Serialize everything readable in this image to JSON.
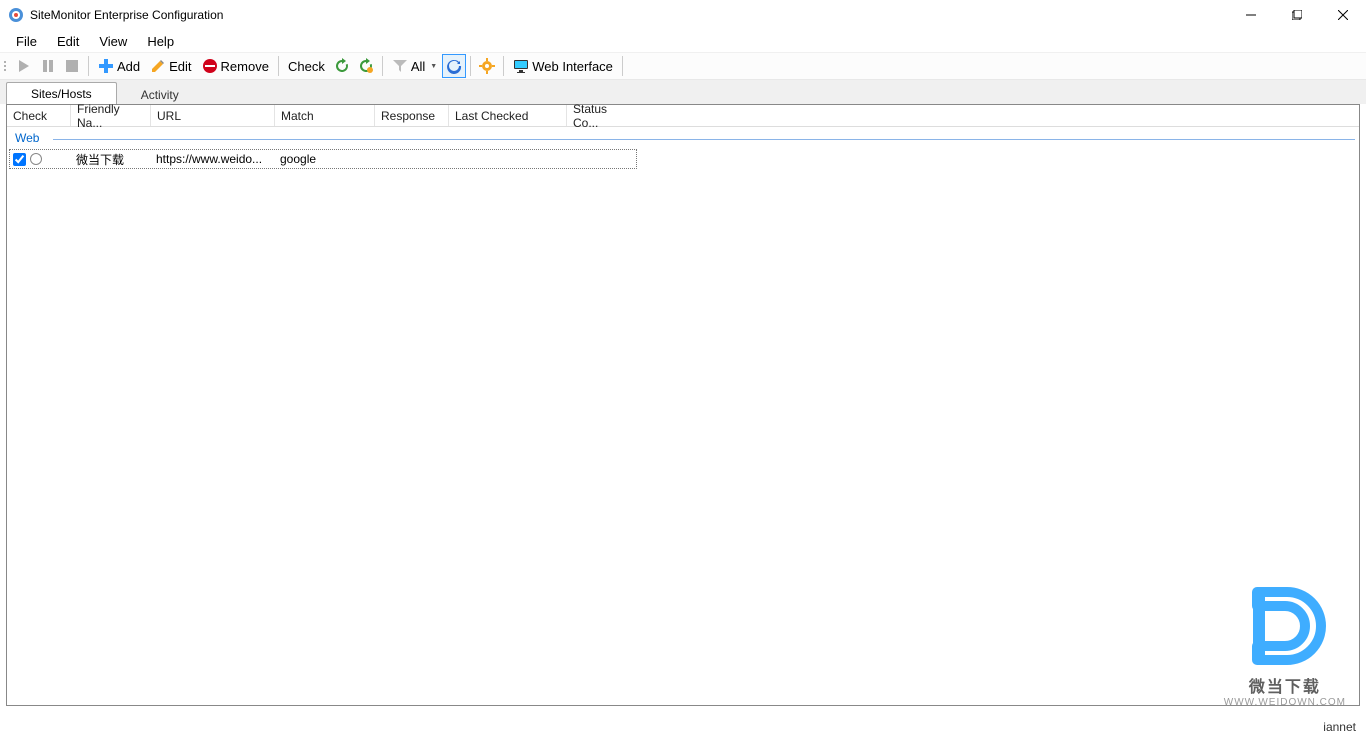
{
  "window": {
    "title": "SiteMonitor Enterprise Configuration"
  },
  "menu": {
    "file": "File",
    "edit": "Edit",
    "view": "View",
    "help": "Help"
  },
  "toolbar": {
    "add": "Add",
    "edit": "Edit",
    "remove": "Remove",
    "check": "Check",
    "all": "All",
    "web_interface": "Web Interface"
  },
  "tabs": {
    "sites": "Sites/Hosts",
    "activity": "Activity"
  },
  "columns": {
    "check": "Check",
    "friendly": "Friendly Na...",
    "url": "URL",
    "match": "Match",
    "response": "Response",
    "last_checked": "Last Checked",
    "status": "Status Co..."
  },
  "group": {
    "web": "Web"
  },
  "rows": [
    {
      "checked": true,
      "friendly": "微当下载",
      "url": "https://www.weido...",
      "match": "google",
      "response": "",
      "last_checked": "",
      "status": ""
    }
  ],
  "statusbar": {
    "user": "iannet"
  },
  "watermark": {
    "cn": "微当下载",
    "url": "WWW.WEIDOWN.COM"
  }
}
